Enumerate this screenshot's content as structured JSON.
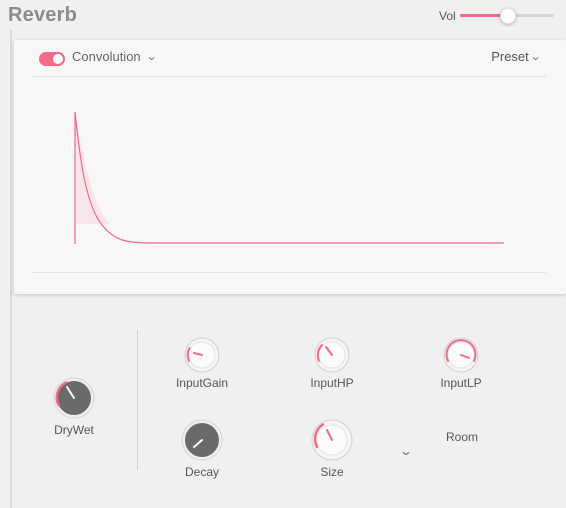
{
  "header": {
    "title": "Reverb",
    "vol_label": "Vol",
    "vol_value": 0.5
  },
  "panel": {
    "toggle_on": true,
    "mode": "Convolution",
    "preset": "Preset",
    "accent": "#f06a89"
  },
  "knobs": {
    "drywet": {
      "label": "DryWet",
      "value": 0.15
    },
    "input_gain": {
      "label": "InputGain",
      "value": 0.45
    },
    "input_hp": {
      "label": "InputHP",
      "value": 0.12
    },
    "input_lp": {
      "label": "InputLP",
      "value": 0.92
    },
    "decay": {
      "label": "Decay",
      "value": 0.0
    },
    "size": {
      "label": "Size",
      "value": 0.12
    }
  },
  "room": {
    "label": "Room"
  },
  "icons": {
    "dropdown": "chevron-down-icon",
    "preset_dropdown": "chevron-down-icon",
    "room_dropdown": "chevron-down-icon"
  }
}
